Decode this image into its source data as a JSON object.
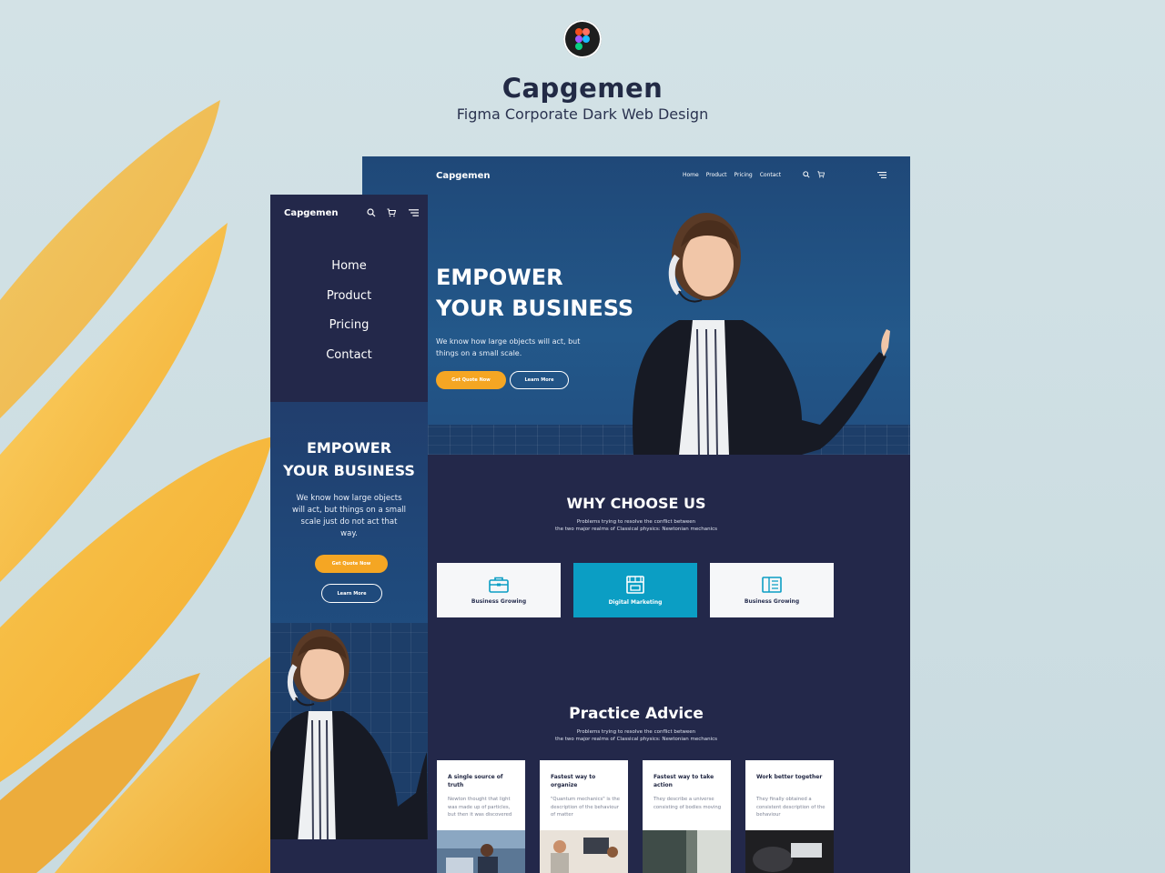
{
  "showcase": {
    "title": "Capgemen",
    "subtitle": "Figma Corporate Dark Web Design",
    "logo_icon": "figma-logo-icon"
  },
  "colors": {
    "background": "#cfdfe3",
    "navy": "#23284a",
    "hero_blue": "#23588a",
    "orange": "#f5a623",
    "teal": "#0b9ec4",
    "petal": "#f6b93b"
  },
  "desktop": {
    "brand": "Capgemen",
    "nav": [
      "Home",
      "Product",
      "Pricing",
      "Contact"
    ],
    "icons": [
      "search-icon",
      "cart-icon",
      "menu-icon"
    ],
    "hero": {
      "title_line1": "EMPOWER",
      "title_line2": "YOUR BUSINESS",
      "text": "We know how large objects will act, but things on a small scale.",
      "primary_button": "Get Quote Now",
      "secondary_button": "Learn More"
    },
    "why": {
      "title": "WHY CHOOSE US",
      "subtitle_line1": "Problems trying to resolve the conflict between",
      "subtitle_line2": "the two major realms of Classical physics: Newtonian mechanics",
      "cards": [
        {
          "label": "Business Growing",
          "icon": "briefcase-icon"
        },
        {
          "label": "Digital Marketing",
          "icon": "storefront-icon"
        },
        {
          "label": "Business Growing",
          "icon": "book-icon"
        }
      ]
    },
    "advice": {
      "title": "Practice Advice",
      "subtitle_line1": "Problems trying to resolve the conflict between",
      "subtitle_line2": "the two major realms of Classical physics: Newtonian mechanics",
      "cards": [
        {
          "title": "A single source of truth",
          "text": "Newton thought that light was made up of particles, but then it was discovered"
        },
        {
          "title": "Fastest way to organize",
          "text": "\"Quantum mechanics\" is the description of the behaviour of matter"
        },
        {
          "title": "Fastest way to take action",
          "text": "They describe a universe consisting of bodies moving"
        },
        {
          "title": "Work better together",
          "text": "They finally obtained a consistent description of the behaviour"
        }
      ]
    }
  },
  "mobile": {
    "brand": "Capgemen",
    "menu": [
      "Home",
      "Product",
      "Pricing",
      "Contact"
    ],
    "hero": {
      "title_line1": "EMPOWER",
      "title_line2": "YOUR BUSINESS",
      "text": "We know how large objects will act, but things on a small scale just do not act that way.",
      "primary_button": "Get Quote Now",
      "secondary_button": "Learn More"
    }
  }
}
